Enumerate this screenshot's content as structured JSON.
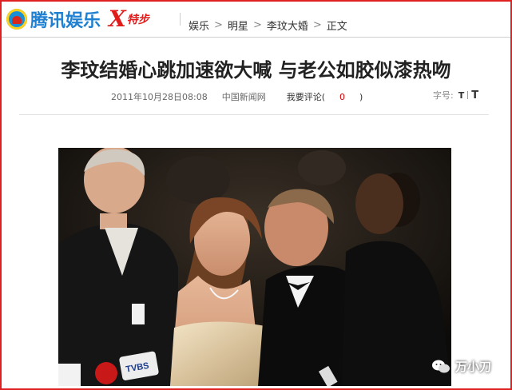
{
  "header": {
    "logo_text": "腾讯娱乐",
    "brand_x": "X",
    "brand_text": "特步",
    "breadcrumb": [
      "娱乐",
      "明星",
      "李玟大婚",
      "正文"
    ]
  },
  "article": {
    "title": "李玟结婚心跳加速欲大喊  与老公如胶似漆热吻",
    "date": "2011年10月28日08:08",
    "source": "中国新闻网",
    "comment_label": "我要评论(",
    "comment_count": "0",
    "comment_close": ")",
    "font_size_label": "字号:",
    "font_small": "T",
    "font_large": "T"
  },
  "photo": {
    "sign_text": "TVBS"
  },
  "watermark": {
    "text": "万小刀"
  },
  "colors": {
    "frame_border": "#e02020",
    "logo_blue": "#1f7fd1",
    "brand_red": "#e01b1b",
    "comment_count": "#cc0000"
  },
  "icons": [
    "tencent-logo-icon",
    "wechat-icon"
  ]
}
